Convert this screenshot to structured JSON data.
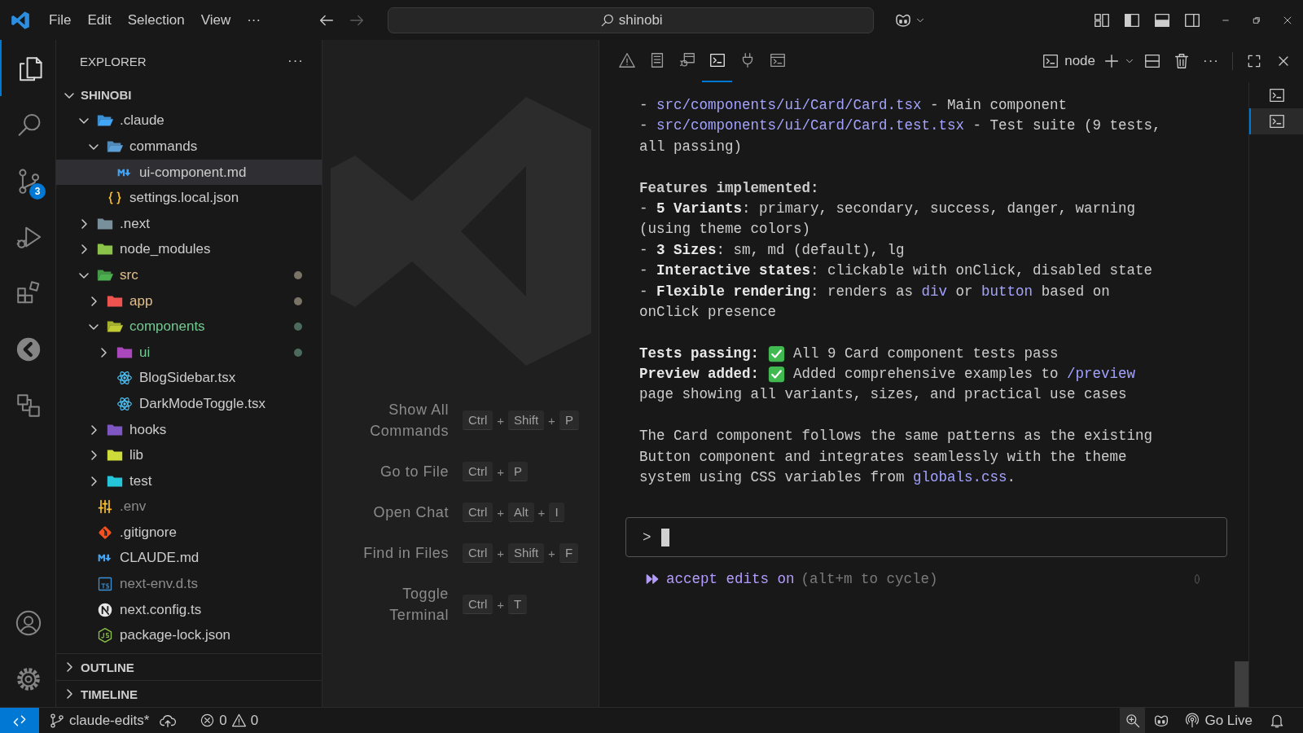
{
  "title_bar": {
    "menus": [
      "File",
      "Edit",
      "Selection",
      "View"
    ],
    "more": "···",
    "nav": [
      {
        "disabled": false
      },
      {
        "disabled": true
      }
    ],
    "search": {
      "value": "shinobi"
    }
  },
  "activity_bar": {
    "items": [
      {
        "selected": true
      },
      {
        "selected": false
      },
      {
        "selected": false,
        "badge": "3"
      },
      {
        "selected": false
      },
      {
        "selected": false
      },
      {
        "selected": false
      },
      {
        "selected": false
      }
    ]
  },
  "explorer": {
    "title": "EXPLORER",
    "more": "···",
    "root": {
      "label": "SHINOBI",
      "expanded": true,
      "children": [
        {
          "label": ".claude",
          "kind": "folder",
          "color": "#42a5f5",
          "expanded": true,
          "selected": false,
          "children": [
            {
              "label": "commands",
              "kind": "folder",
              "color": "#5c9fd6",
              "expanded": true,
              "selected": false,
              "children": [
                {
                  "label": "ui-component.md",
                  "kind": "markdown",
                  "selected": true
                }
              ]
            },
            {
              "label": "settings.local.json",
              "kind": "json",
              "selected": false
            }
          ]
        },
        {
          "label": ".next",
          "kind": "folder",
          "color": "#78909c",
          "expanded": false,
          "selected": false
        },
        {
          "label": "node_modules",
          "kind": "folder",
          "color": "#8bc34a",
          "expanded": false,
          "selected": false
        },
        {
          "label": "src",
          "kind": "folder",
          "color": "#4caf50",
          "expanded": true,
          "selected": false,
          "modified": true,
          "children": [
            {
              "label": "app",
              "kind": "folder",
              "color": "#ef5350",
              "expanded": false,
              "selected": false,
              "modified": true
            },
            {
              "label": "components",
              "kind": "folder",
              "color": "#c0ca33",
              "expanded": true,
              "selected": false,
              "untracked": true,
              "children": [
                {
                  "label": "ui",
                  "kind": "folder",
                  "color": "#ab47bc",
                  "expanded": false,
                  "selected": false,
                  "untracked": true
                },
                {
                  "label": "BlogSidebar.tsx",
                  "kind": "react",
                  "selected": false
                },
                {
                  "label": "DarkModeToggle.tsx",
                  "kind": "react",
                  "selected": false
                }
              ]
            },
            {
              "label": "hooks",
              "kind": "folder",
              "color": "#7e57c2",
              "expanded": false,
              "selected": false
            },
            {
              "label": "lib",
              "kind": "folder",
              "color": "#cddc39",
              "expanded": false,
              "selected": false
            },
            {
              "label": "test",
              "kind": "folder",
              "color": "#26c6da",
              "expanded": false,
              "selected": false
            }
          ]
        },
        {
          "label": ".env",
          "kind": "env",
          "selected": false,
          "ignored": true
        },
        {
          "label": ".gitignore",
          "kind": "git",
          "selected": false
        },
        {
          "label": "CLAUDE.md",
          "kind": "markdown",
          "selected": false
        },
        {
          "label": "next-env.d.ts",
          "kind": "ts",
          "selected": false,
          "ignored": true
        },
        {
          "label": "next.config.ts",
          "kind": "next",
          "selected": false
        },
        {
          "label": "package-lock.json",
          "kind": "js",
          "selected": false
        }
      ]
    },
    "sections": [
      {
        "label": "OUTLINE",
        "expanded": false
      },
      {
        "label": "TIMELINE",
        "expanded": false
      }
    ]
  },
  "editor": {
    "shortcuts": [
      {
        "label": "Show All Commands",
        "keys": [
          "Ctrl",
          "+",
          "Shift",
          "+",
          "P"
        ]
      },
      {
        "label": "Go to File",
        "keys": [
          "Ctrl",
          "+",
          "P"
        ]
      },
      {
        "label": "Open Chat",
        "keys": [
          "Ctrl",
          "+",
          "Alt",
          "+",
          "I"
        ]
      },
      {
        "label": "Find in Files",
        "keys": [
          "Ctrl",
          "+",
          "Shift",
          "+",
          "F"
        ]
      },
      {
        "label": "Toggle Terminal",
        "keys": [
          "Ctrl",
          "+",
          "T"
        ]
      }
    ]
  },
  "panel": {
    "tabs": [
      {
        "selected": false
      },
      {
        "selected": false
      },
      {
        "selected": false
      },
      {
        "selected": true
      },
      {
        "selected": false
      },
      {
        "selected": false
      }
    ],
    "terminal_name": "node",
    "more": "···",
    "terminals": [
      {
        "selected": false
      },
      {
        "selected": true
      }
    ],
    "lines": [
      {
        "kind": "text",
        "segments": [
          {
            "kind": "text",
            "text": "- "
          },
          {
            "kind": "link",
            "text": "src/components/ui/Card/Card.tsx"
          },
          {
            "kind": "text",
            "text": " - Main component"
          }
        ]
      },
      {
        "kind": "text",
        "segments": [
          {
            "kind": "text",
            "text": "- "
          },
          {
            "kind": "link",
            "text": "src/components/ui/Card/Card.test.tsx"
          },
          {
            "kind": "text",
            "text": " - Test suite (9 tests,"
          }
        ]
      },
      {
        "kind": "text",
        "segments": [
          {
            "kind": "text",
            "text": "all passing)"
          }
        ]
      },
      {
        "kind": "blank"
      },
      {
        "kind": "heading",
        "segments": [
          {
            "kind": "text",
            "text": "Features implemented:"
          }
        ]
      },
      {
        "kind": "text",
        "segments": [
          {
            "kind": "text",
            "text": "- **5 Variants**: primary, secondary, success, danger, warning"
          }
        ]
      },
      {
        "kind": "text",
        "segments": [
          {
            "kind": "text",
            "text": "(using theme colors)"
          }
        ]
      },
      {
        "kind": "text",
        "segments": [
          {
            "kind": "text",
            "text": "- **3 Sizes**: sm, md (default), lg"
          }
        ]
      },
      {
        "kind": "text",
        "segments": [
          {
            "kind": "text",
            "text": "- **Interactive states**: clickable with onClick, disabled state"
          }
        ]
      },
      {
        "kind": "text",
        "segments": [
          {
            "kind": "text",
            "text": "- **Flexible rendering**: renders as "
          },
          {
            "kind": "link",
            "text": "div"
          },
          {
            "kind": "text",
            "text": " or "
          },
          {
            "kind": "link",
            "text": "button"
          },
          {
            "kind": "text",
            "text": " based on"
          }
        ]
      },
      {
        "kind": "text",
        "segments": [
          {
            "kind": "text",
            "text": "onClick presence"
          }
        ]
      },
      {
        "kind": "blank"
      },
      {
        "kind": "text",
        "segments": [
          {
            "kind": "text",
            "text": "**Tests passing:** "
          },
          {
            "kind": "check"
          },
          {
            "kind": "text",
            "text": " All 9 Card component tests pass"
          }
        ]
      },
      {
        "kind": "text",
        "segments": [
          {
            "kind": "text",
            "text": "**Preview added:** "
          },
          {
            "kind": "check"
          },
          {
            "kind": "text",
            "text": " Added comprehensive examples to "
          },
          {
            "kind": "link",
            "text": "/preview"
          }
        ]
      },
      {
        "kind": "text",
        "segments": [
          {
            "kind": "text",
            "text": "page showing all variants, sizes, and practical use cases"
          }
        ]
      },
      {
        "kind": "blank"
      },
      {
        "kind": "text",
        "segments": [
          {
            "kind": "text",
            "text": "The Card component follows the same patterns as the existing"
          }
        ]
      },
      {
        "kind": "text",
        "segments": [
          {
            "kind": "text",
            "text": "Button component and integrates seamlessly with the theme"
          }
        ]
      },
      {
        "kind": "text",
        "segments": [
          {
            "kind": "text",
            "text": "system using CSS variables from "
          },
          {
            "kind": "link",
            "text": "globals.css"
          },
          {
            "kind": "text",
            "text": "."
          }
        ]
      }
    ],
    "input": {
      "prompt": ">"
    },
    "mode": {
      "label": "accept edits on",
      "hint": "(alt+m to cycle)"
    }
  },
  "status_bar": {
    "branch": "claude-edits*",
    "errors": "0",
    "warnings": "0",
    "go_live": "Go Live"
  }
}
